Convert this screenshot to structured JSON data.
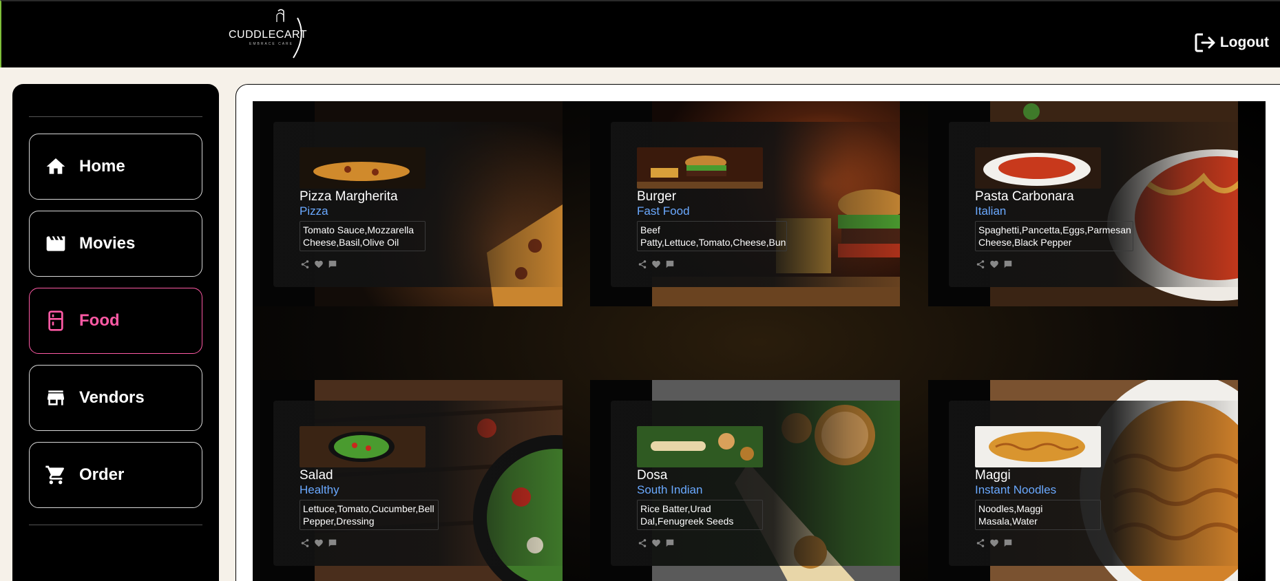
{
  "header": {
    "logo_text": "CUDDLECART",
    "logo_tagline": "EMBRACE CARE",
    "logout_label": "Logout"
  },
  "sidebar": {
    "items": [
      {
        "label": "Home",
        "icon": "home-icon"
      },
      {
        "label": "Movies",
        "icon": "movie-icon"
      },
      {
        "label": "Food",
        "icon": "food-icon",
        "active": true
      },
      {
        "label": "Vendors",
        "icon": "store-icon"
      },
      {
        "label": "Order",
        "icon": "cart-icon"
      }
    ]
  },
  "colors": {
    "active": "#ff5aa5",
    "category": "#6aa9ff",
    "background": "#000000"
  },
  "foods": [
    {
      "name": "Pizza Margherita",
      "category": "Pizza",
      "ingredients": "Tomato Sauce,Mozzarella Cheese,Basil,Olive Oil"
    },
    {
      "name": "Burger",
      "category": "Fast Food",
      "ingredients": "Beef Patty,Lettuce,Tomato,Cheese,Bun"
    },
    {
      "name": "Pasta Carbonara",
      "category": "Italian",
      "ingredients": "Spaghetti,Pancetta,Eggs,Parmesan Cheese,Black Pepper"
    },
    {
      "name": "Salad",
      "category": "Healthy",
      "ingredients": "Lettuce,Tomato,Cucumber,Bell Pepper,Dressing"
    },
    {
      "name": "Dosa",
      "category": "South Indian",
      "ingredients": "Rice Batter,Urad Dal,Fenugreek Seeds"
    },
    {
      "name": "Maggi",
      "category": "Instant Noodles",
      "ingredients": "Noodles,Maggi Masala,Water"
    }
  ],
  "card_actions": [
    "share-icon",
    "heart-icon",
    "comment-icon"
  ]
}
